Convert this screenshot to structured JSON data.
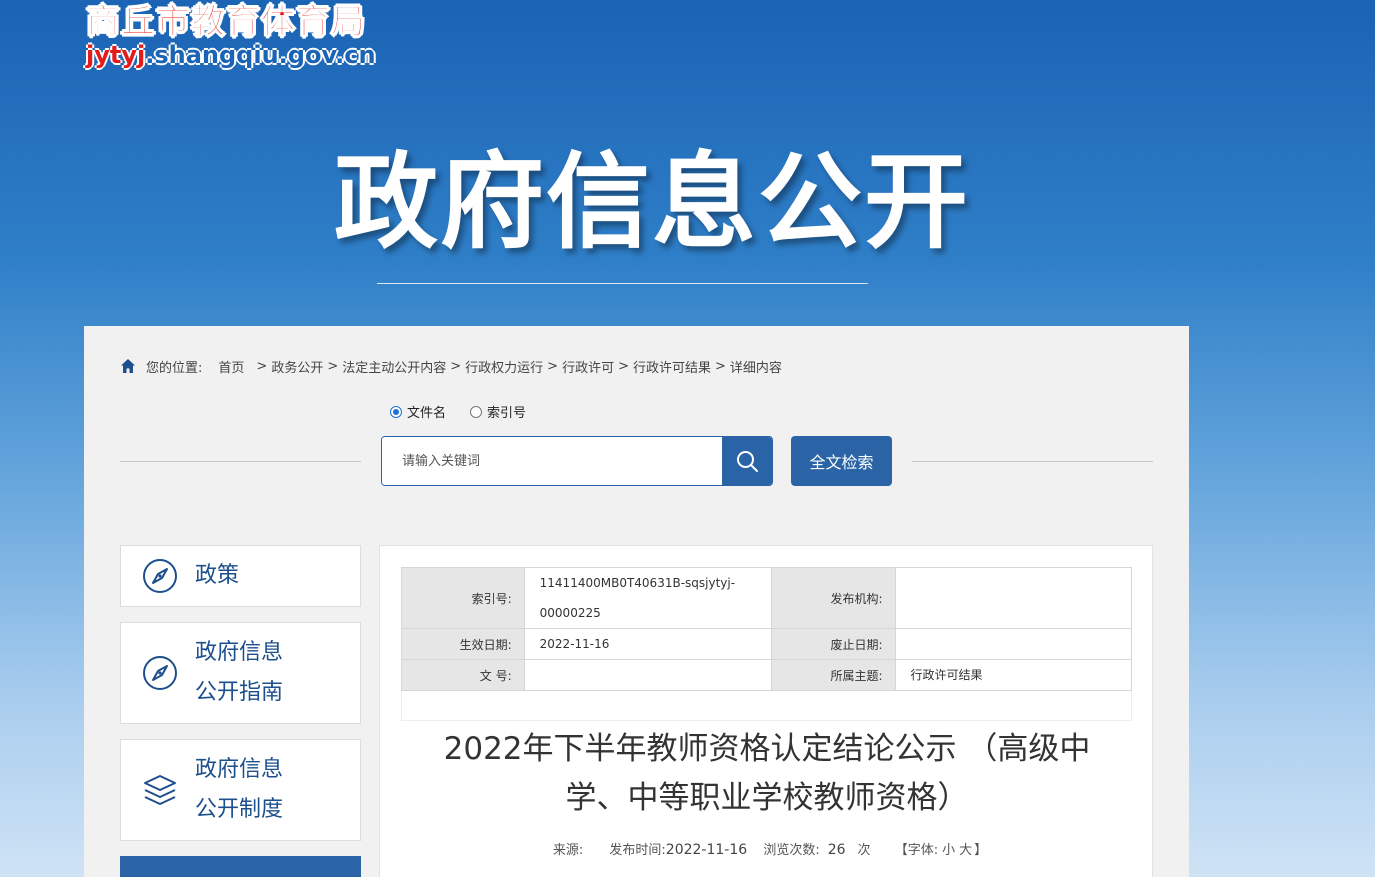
{
  "header": {
    "logo_cn": "商丘市教育体育局",
    "logo_url_red": "jytyj",
    "logo_url_rest": ".shangqiu.gov.cn",
    "hero_title": "政府信息公开"
  },
  "breadcrumb": {
    "label": "您的位置:",
    "items": [
      "首页",
      "政务公开",
      "法定主动公开内容",
      "行政权力运行",
      "行政许可",
      "行政许可结果",
      "详细内容"
    ],
    "separator": ">"
  },
  "search": {
    "radio_filename": "文件名",
    "radio_index": "索引号",
    "selected": "filename",
    "placeholder": "请输入关键词",
    "fulltext_label": "全文检索"
  },
  "sidebar": {
    "items": [
      {
        "line1": "政策",
        "line2": ""
      },
      {
        "line1": "政府信息",
        "line2": "公开指南"
      },
      {
        "line1": "政府信息",
        "line2": "公开制度"
      }
    ]
  },
  "meta": {
    "index_key": "索引号:",
    "index_value": "11411400MB0T40631B-sqsjytyj-00000225",
    "publisher_key": "发布机构:",
    "publisher_value": "",
    "effective_key": "生效日期:",
    "effective_value": "2022-11-16",
    "abolish_key": "废止日期:",
    "abolish_value": "",
    "docno_key": "文 号:",
    "docno_value": "",
    "topic_key": "所属主题:",
    "topic_value": "行政许可结果"
  },
  "document": {
    "title": "2022年下半年教师资格认定结论公示 （高级中学、中等职业学校教师资格）",
    "source_label": "来源:",
    "source_value": "",
    "publish_label": "发布时间:",
    "publish_value": "2022-11-16",
    "views_label": "浏览次数:",
    "views_value": "26",
    "views_unit": "次",
    "font_label": "【字体:",
    "font_small": "小",
    "font_large": "大",
    "font_close": "】"
  },
  "colors": {
    "primary": "#2a64a6",
    "logo_red": "#e41b1b",
    "side_text": "#1d4f8c"
  }
}
